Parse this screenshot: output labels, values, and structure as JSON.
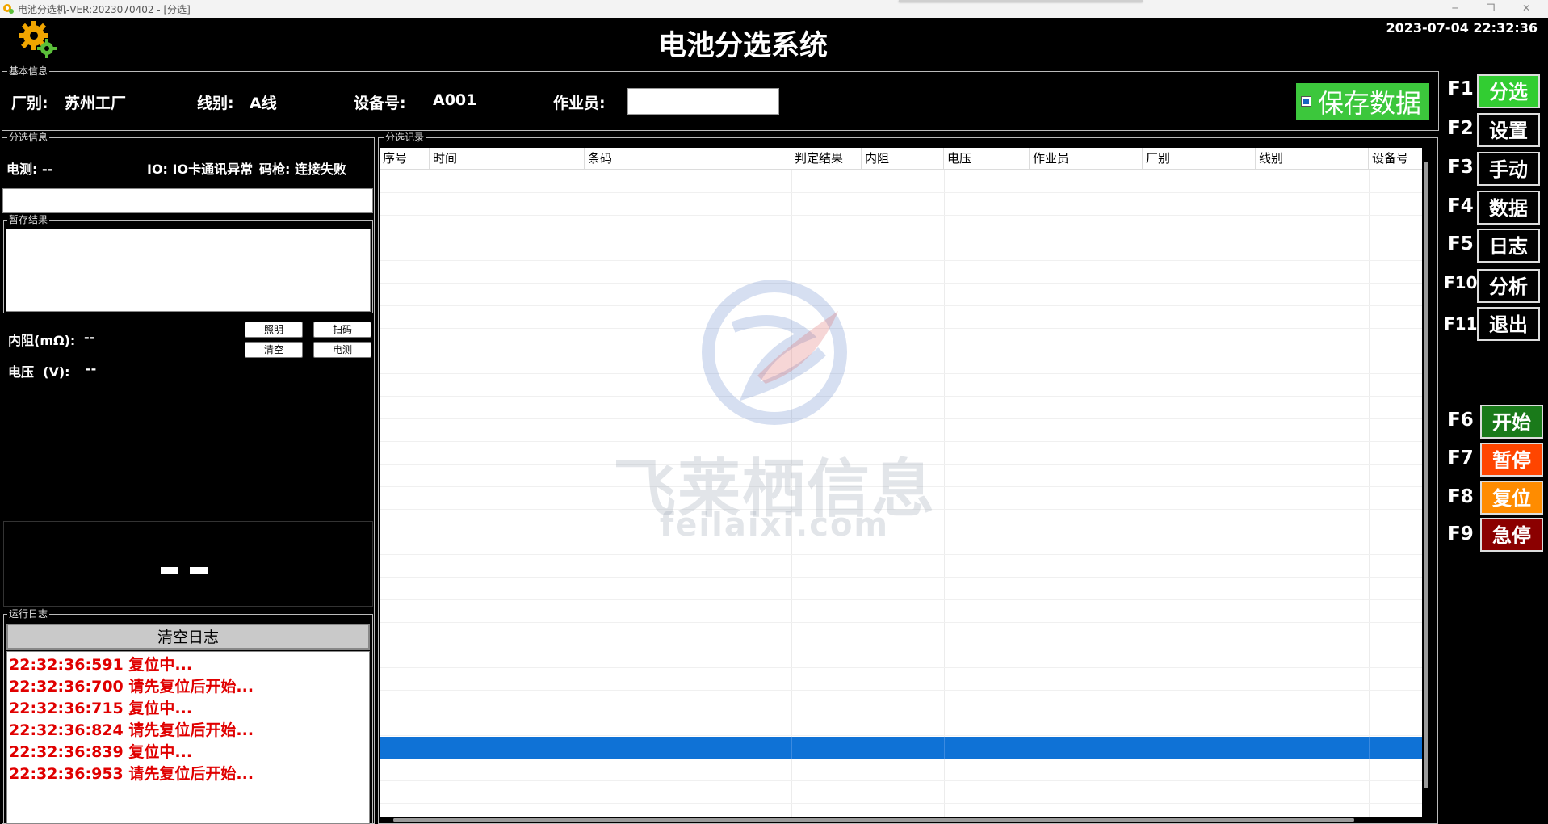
{
  "window": {
    "title": "电池分选机-VER:2023070402 - [分选]",
    "min_icon": "minimize-icon",
    "max_icon": "maximize-icon",
    "close_icon": "close-icon"
  },
  "header": {
    "app_title": "电池分选系统",
    "datetime": "2023-07-04 22:32:36",
    "logo_icon": "gear-icon"
  },
  "basic_info": {
    "legend": "基本信息",
    "factory_label": "厂别:",
    "factory_value": "苏州工厂",
    "line_label": "线别:",
    "line_value": "A线",
    "device_label": "设备号:",
    "device_value": "A001",
    "operator_label": "作业员:",
    "operator_value": "",
    "save_label": "保存数据",
    "save_checked": true
  },
  "sort_info": {
    "legend": "分选信息",
    "electric_test": "电测: --",
    "io_status": "IO: IO卡通讯异常",
    "scanner_status": "码枪: 连接失败",
    "barcode_value": "",
    "temp_legend": "暂存结果",
    "resistance_label": "内阻(mΩ):",
    "resistance_value": "--",
    "voltage_label": "电压  (V):",
    "voltage_value": "--",
    "buttons": {
      "light": "照明",
      "scan": "扫码",
      "clear": "清空",
      "test": "电测"
    }
  },
  "log": {
    "legend": "运行日志",
    "clear_label": "清空日志",
    "lines": [
      "22:32:36:591 复位中...",
      "22:32:36:700 请先复位后开始...",
      "22:32:36:715 复位中...",
      "22:32:36:824 请先复位后开始...",
      "22:32:36:839 复位中...",
      "22:32:36:953 请先复位后开始..."
    ]
  },
  "records": {
    "legend": "分选记录",
    "columns": [
      "序号",
      "时间",
      "条码",
      "判定结果",
      "内阻",
      "电压",
      "作业员",
      "厂别",
      "线别",
      "设备号"
    ],
    "rows": []
  },
  "watermark": {
    "text": "飞莱栖信息",
    "sub": "feilaixi.com"
  },
  "fkeys": [
    {
      "key": "F1",
      "label": "分选",
      "style": "green"
    },
    {
      "key": "F2",
      "label": "设置",
      "style": "dark"
    },
    {
      "key": "F3",
      "label": "手动",
      "style": "dark"
    },
    {
      "key": "F4",
      "label": "数据",
      "style": "dark"
    },
    {
      "key": "F5",
      "label": "日志",
      "style": "dark"
    },
    {
      "key": "F10",
      "label": "分析",
      "style": "dark"
    },
    {
      "key": "F11",
      "label": "退出",
      "style": "dark"
    },
    {
      "key": "F6",
      "label": "开始",
      "style": "run-green"
    },
    {
      "key": "F7",
      "label": "暂停",
      "style": "orange-red"
    },
    {
      "key": "F8",
      "label": "复位",
      "style": "orange"
    },
    {
      "key": "F9",
      "label": "急停",
      "style": "dark-red"
    }
  ],
  "colors": {
    "accent_green": "#32cd32",
    "selection_blue": "#0f72d6",
    "log_red": "#e00000",
    "pause_orange": "#ff4500",
    "reset_orange": "#ff8c00",
    "estop_red": "#8b0000"
  }
}
